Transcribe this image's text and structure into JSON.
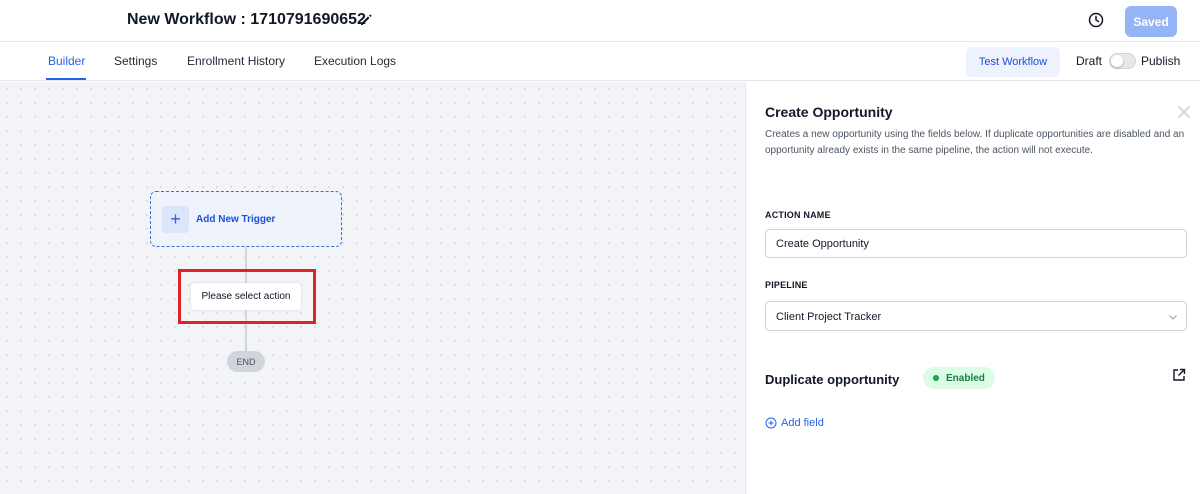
{
  "header": {
    "workflow_title": "New Workflow : 1710791690652",
    "saved_label": "Saved"
  },
  "tabs": [
    {
      "label": "Builder",
      "active": true
    },
    {
      "label": "Settings",
      "active": false
    },
    {
      "label": "Enrollment History",
      "active": false
    },
    {
      "label": "Execution Logs",
      "active": false
    }
  ],
  "toolbar": {
    "test_label": "Test Workflow",
    "draft_label": "Draft",
    "publish_label": "Publish",
    "publish_on": false
  },
  "canvas": {
    "trigger_label": "Add New Trigger",
    "action_label": "Please select action",
    "end_label": "END"
  },
  "panel": {
    "title": "Create Opportunity",
    "description": "Creates a new opportunity using the fields below. If duplicate opportunities are disabled and an opportunity already exists in the same pipeline, the action will not execute.",
    "action_name_label": "ACTION NAME",
    "action_name_value": "Create Opportunity",
    "pipeline_label": "PIPELINE",
    "pipeline_value": "Client Project Tracker",
    "duplicate_title": "Duplicate opportunity",
    "duplicate_status": "Enabled",
    "add_field_label": "Add field"
  },
  "colors": {
    "accent": "#2563eb",
    "highlight": "#dc2626",
    "enabled_bg": "#dcfce7"
  }
}
